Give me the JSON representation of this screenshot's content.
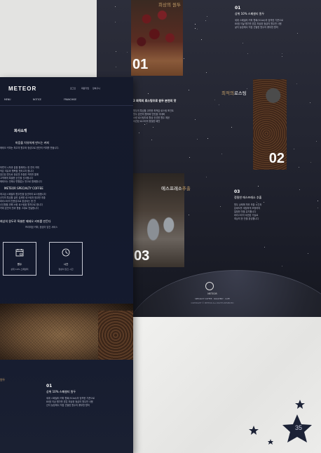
{
  "poster": {
    "panel1": {
      "number": "01",
      "title_right": "희상의 원두",
      "heading": "01",
      "subheading": "상위 10% 스페셜티 원두",
      "body": "세계 스페셜티 커피 협회(SCAA)의 엄격한 기준으로\n80점 이상 평가를 받은 최상위 등급의 원두만 사용\n산지 농장에서 직접 선별한 원두의 풍부한 향미"
    },
    "panel2": {
      "number": "02",
      "title_left": "최적의",
      "title_right": "로스팅",
      "heading": "2 최적의 로스팅으로 원두 본연의 맛",
      "body": "원두의 특성을 고려한 최적의 로스팅 포인트\n원두 본연의 향미와 단맛을 극대화\n소량 로스팅으로 항상 신선한 원두 제공\n숙련된 로스터의 정밀한 배전"
    },
    "panel3": {
      "number": "03",
      "title_left": "에스프레소",
      "title_right": "추출",
      "heading": "03",
      "subheading": "정밀한 에스프레소 추출",
      "body": "원두 상태에 따라 추출 시간과\n분쇄도를 세밀하게 조정하여\n일정한 맛을 유지합니다\n바리스타의 숙련된 기술로\n최상의 한 잔을 완성합니다"
    },
    "footer": {
      "line1": "METEOR",
      "line2": "SPECIALTY COFFEE · ROASTERY · CAFE",
      "copyright": "COPYRIGHT © METEOR ALL RIGHTS RESERVED"
    }
  },
  "page": {
    "logo": "METEOR",
    "topnav": [
      "로그인",
      "회원가입",
      "장바구니"
    ],
    "menu": [
      "MENU",
      "NOTICE",
      "FRANCHISE"
    ],
    "section_title": "회사소개",
    "lead": "마음을 치유하게 만드는 커피",
    "lead_body": "메테오 커피는 최고의 원두와 정성으로 한잔의 커피를 만듭니다.",
    "paragraph": "하루의 시작과 끝을 함께하는 한 잔의 커피\n작은 여유와 행복을 전하고자 합니다\n엄선된 원두로 정성껏 추출한 커피를 통해\n고객에게 특별한 순간을 선사합니다\n메테오는 언제나 변함없는 맛으로 함께합니다",
    "specialty_title": "METEOR SPECIALTY COFFEE",
    "specialty_body": "최고급 스페셜티 원두만을 엄선하여 로스팅합니다\n산지의 특성을 살린 섬세한 로스팅과 정교한 추출\n바리스타의 전문성으로 완성되는 한 잔\n신선함을 위해 소량 로스팅을 원칙으로 합니다\n커피 본연의 맛과 향을 그대로 전달합니다",
    "promise_title": "최상의 원두로 특별한 메테오 커피를 만든다",
    "promise_sub": "프리미엄 커피, 정성이 담긴 서비스",
    "boxes": [
      {
        "title": "원두",
        "sub": "상위 10% 스페셜티"
      },
      {
        "title": "시간",
        "sub": "정성이 담긴 시간"
      }
    ],
    "bottom": {
      "heading": "01",
      "subheading": "상위 10% 스페셜티 원두",
      "body": "세계 스페셜티 커피 협회(SCAA)의 엄격한 기준으로\n80점 이상 평가를 받은 최상위 등급의 원두만 사용\n산지 농장에서 직접 선별한 원두의 풍부한 향미"
    },
    "side_label": "원두"
  },
  "badge": {
    "number": "35"
  },
  "colors": {
    "accent": "#c9a36b",
    "panel": "#151a2b",
    "poster": "#232531"
  }
}
